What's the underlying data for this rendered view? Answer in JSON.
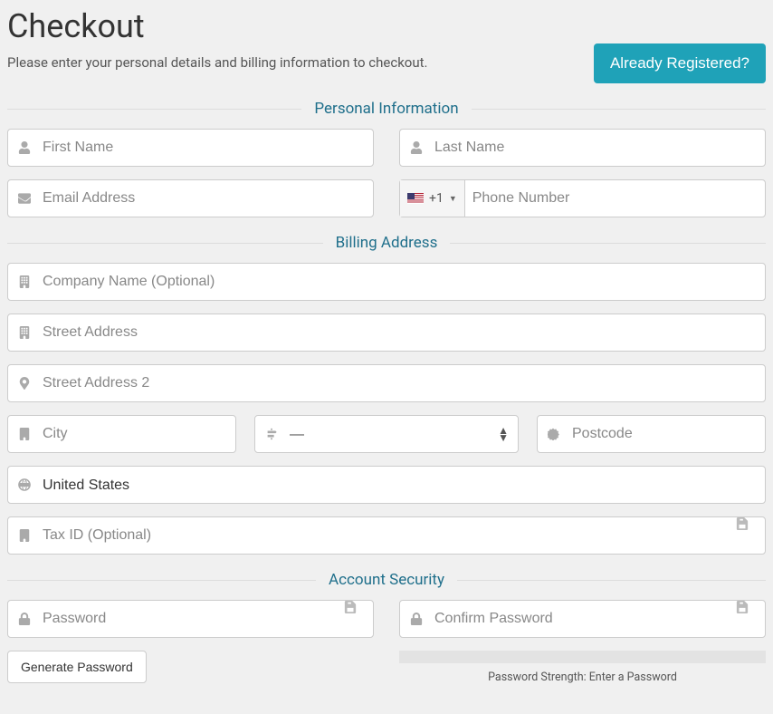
{
  "header": {
    "title": "Checkout",
    "subtitle": "Please enter your personal details and billing information to checkout.",
    "already_registered": "Already Registered?"
  },
  "sections": {
    "personal": "Personal Information",
    "billing": "Billing Address",
    "security": "Account Security"
  },
  "personal": {
    "first_name_placeholder": "First Name",
    "last_name_placeholder": "Last Name",
    "email_placeholder": "Email Address",
    "phone_placeholder": "Phone Number",
    "phone_prefix": "+1"
  },
  "billing": {
    "company_placeholder": "Company Name (Optional)",
    "address1_placeholder": "Street Address",
    "address2_placeholder": "Street Address 2",
    "city_placeholder": "City",
    "state_placeholder": "—",
    "postcode_placeholder": "Postcode",
    "country_value": "United States",
    "tax_id_placeholder": "Tax ID (Optional)"
  },
  "security": {
    "password_placeholder": "Password",
    "confirm_placeholder": "Confirm Password",
    "generate_button": "Generate Password",
    "strength_label": "Password Strength: Enter a Password"
  }
}
